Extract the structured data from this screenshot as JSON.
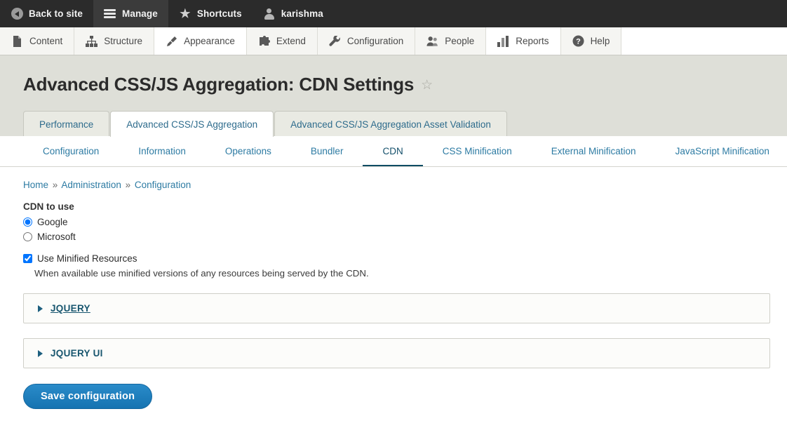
{
  "admin_toolbar": {
    "items": [
      {
        "label": "Back to site",
        "icon": "back-circle-icon",
        "active": false
      },
      {
        "label": "Manage",
        "icon": "hamburger-icon",
        "active": true
      },
      {
        "label": "Shortcuts",
        "icon": "star-icon",
        "active": false
      },
      {
        "label": "karishma",
        "icon": "user-icon",
        "active": false
      }
    ]
  },
  "admin_tray": {
    "items": [
      {
        "label": "Content",
        "icon": "file-icon"
      },
      {
        "label": "Structure",
        "icon": "sitemap-icon"
      },
      {
        "label": "Appearance",
        "icon": "paintbrush-icon"
      },
      {
        "label": "Extend",
        "icon": "puzzle-piece-icon"
      },
      {
        "label": "Configuration",
        "icon": "wrench-icon"
      },
      {
        "label": "People",
        "icon": "people-icon"
      },
      {
        "label": "Reports",
        "icon": "bar-chart-icon"
      },
      {
        "label": "Help",
        "icon": "question-circle-icon"
      }
    ]
  },
  "page": {
    "title": "Advanced CSS/JS Aggregation: CDN Settings",
    "star_glyph": "☆"
  },
  "primary_tabs": [
    {
      "label": "Performance",
      "active": false
    },
    {
      "label": "Advanced CSS/JS Aggregation",
      "active": true
    },
    {
      "label": "Advanced CSS/JS Aggregation Asset Validation",
      "active": false
    }
  ],
  "secondary_tabs": [
    {
      "label": "Configuration",
      "active": false
    },
    {
      "label": "Information",
      "active": false
    },
    {
      "label": "Operations",
      "active": false
    },
    {
      "label": "Bundler",
      "active": false
    },
    {
      "label": "CDN",
      "active": true
    },
    {
      "label": "CSS Minification",
      "active": false
    },
    {
      "label": "External Minification",
      "active": false
    },
    {
      "label": "JavaScript Minification",
      "active": false
    }
  ],
  "breadcrumb": {
    "items": [
      "Home",
      "Administration",
      "Configuration"
    ],
    "separator": "»"
  },
  "form": {
    "cdn_to_use_label": "CDN to use",
    "radios": [
      {
        "label": "Google",
        "checked": true
      },
      {
        "label": "Microsoft",
        "checked": false
      }
    ],
    "minified_checkbox": {
      "label": "Use Minified Resources",
      "checked": true,
      "description": "When available use minified versions of any resources being served by the CDN."
    },
    "details": [
      {
        "title": "JQUERY",
        "expanded": false,
        "hovered": true
      },
      {
        "title": "JQUERY UI",
        "expanded": false,
        "hovered": false
      }
    ],
    "save_label": "Save configuration"
  },
  "colors": {
    "toolbar_bg": "#2b2b2b",
    "toolbar_active_bg": "#3b3b3b",
    "tray_bg": "#f5f5f2",
    "page_head_bg": "#dedfd8",
    "content_bg": "#ffffff",
    "link_blue": "#2d7ba3",
    "active_tab_underline": "#0f4c63",
    "button_blue": "#1a7bb9",
    "details_title": "#18566f"
  }
}
